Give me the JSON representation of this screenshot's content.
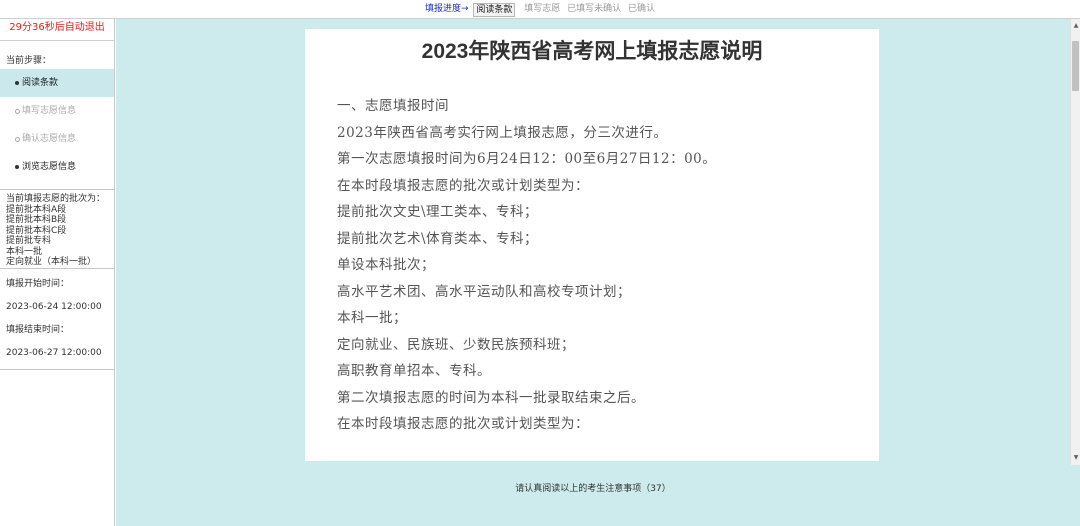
{
  "progress": {
    "lead": "填报进度→",
    "current": "阅读条款",
    "pending": [
      "填写志愿",
      "已填写未确认",
      "已确认"
    ]
  },
  "sidebar": {
    "timer": "29分36秒后自动退出",
    "steps_label": "当前步骤：",
    "steps": [
      {
        "label": "阅读条款",
        "state": "active"
      },
      {
        "label": "填写志愿信息",
        "state": "disabled"
      },
      {
        "label": "确认志愿信息",
        "state": "disabled"
      },
      {
        "label": "浏览志愿信息",
        "state": "normal"
      }
    ],
    "batches_label": "当前填报志愿的批次为：",
    "batches": [
      "提前批本科A段",
      "提前批本科B段",
      "提前批本科C段",
      "提前批专科",
      "本科一批",
      "定向就业（本科一批）"
    ],
    "start_label": "填报开始时间：",
    "start_time": "2023-06-24 12:00:00",
    "end_label": "填报结束时间：",
    "end_time": "2023-06-27 12:00:00"
  },
  "document": {
    "title": "2023年陕西省高考网上填报志愿说明",
    "lines": [
      "一、志愿填报时间",
      "2023年陕西省高考实行网上填报志愿，分三次进行。",
      "第一次志愿填报时间为6月24日12：00至6月27日12：00。",
      "在本时段填报志愿的批次或计划类型为：",
      "提前批次文史\\理工类本、专科；",
      "提前批次艺术\\体育类本、专科；",
      "单设本科批次；",
      "高水平艺术团、高水平运动队和高校专项计划；",
      "本科一批；",
      "定向就业、民族班、少数民族预科班；",
      "高职教育单招本、专科。",
      "第二次填报志愿的时间为本科一批录取结束之后。",
      "在本时段填报志愿的批次或计划类型为："
    ]
  },
  "notice": "请认真阅读以上的考生注意事项（37）",
  "scrollbar": {
    "up_icon": "▲",
    "down_icon": "▼"
  },
  "colors": {
    "main_bg": "#cdebec",
    "active_step": "#cbe9ec",
    "timer": "#e02020",
    "progress_lead": "#1c2fb8"
  }
}
